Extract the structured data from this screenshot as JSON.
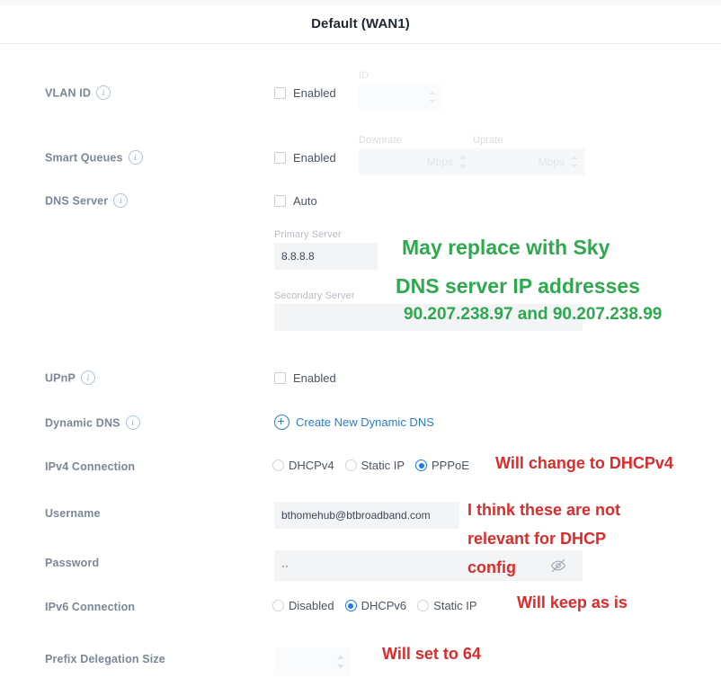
{
  "header": {
    "title": "Default (WAN1)"
  },
  "rows": {
    "vlan": {
      "label": "VLAN ID",
      "info_icon": "info-icon",
      "checkbox_label": "Enabled",
      "checked": false,
      "id_field_label": "ID",
      "id_field_value": ""
    },
    "smart_queues": {
      "label": "Smart Queues",
      "info_icon": "info-icon",
      "checkbox_label": "Enabled",
      "checked": false,
      "downrate_label": "Downrate",
      "downrate_placeholder": "Mbps",
      "uprate_label": "Uprate",
      "uprate_placeholder": "Mbps"
    },
    "dns_server": {
      "label": "DNS Server",
      "info_icon": "info-icon",
      "checkbox_label": "Auto",
      "checked": false,
      "primary_label": "Primary Server",
      "primary_value": "8.8.8.8",
      "secondary_label": "Secondary Server",
      "secondary_value": ""
    },
    "upnp": {
      "label": "UPnP",
      "info_icon": "info-icon",
      "checkbox_label": "Enabled",
      "checked": false
    },
    "dynamic_dns": {
      "label": "Dynamic DNS",
      "info_icon": "info-icon",
      "create_link": "Create New Dynamic DNS",
      "plus_icon": "plus-circle-icon"
    },
    "ipv4": {
      "label": "IPv4 Connection",
      "options": [
        {
          "label": "DHCPv4",
          "selected": false
        },
        {
          "label": "Static IP",
          "selected": false
        },
        {
          "label": "PPPoE",
          "selected": true
        }
      ]
    },
    "username": {
      "label": "Username",
      "value": "bthomehub@btbroadband.com"
    },
    "password": {
      "label": "Password",
      "value": "··",
      "toggle_icon": "eye-off-icon"
    },
    "ipv6": {
      "label": "IPv6 Connection",
      "options": [
        {
          "label": "Disabled",
          "selected": false
        },
        {
          "label": "DHCPv6",
          "selected": true
        },
        {
          "label": "Static IP",
          "selected": false
        }
      ]
    },
    "prefix": {
      "label": "Prefix Delegation Size",
      "value": ""
    }
  },
  "annotations": {
    "dns_green_line1": "May replace with Sky",
    "dns_green_line2": "DNS server IP addresses",
    "dns_green_line3": "90.207.238.97 and 90.207.238.99",
    "ipv4_red": "Will change to DHCPv4",
    "credentials_red_line1": "I think these are not",
    "credentials_red_line2": "relevant for DHCP",
    "credentials_red_line3": "config",
    "ipv6_red": "Will keep as is",
    "prefix_red": "Will set to 64"
  },
  "colors": {
    "green": "#2fa84f",
    "red": "#dc2b2b",
    "accent_blue": "#1f7ae0",
    "link_blue": "#2a7ec7",
    "label_gray": "#7b8794",
    "field_bg": "#f3f4f6"
  }
}
